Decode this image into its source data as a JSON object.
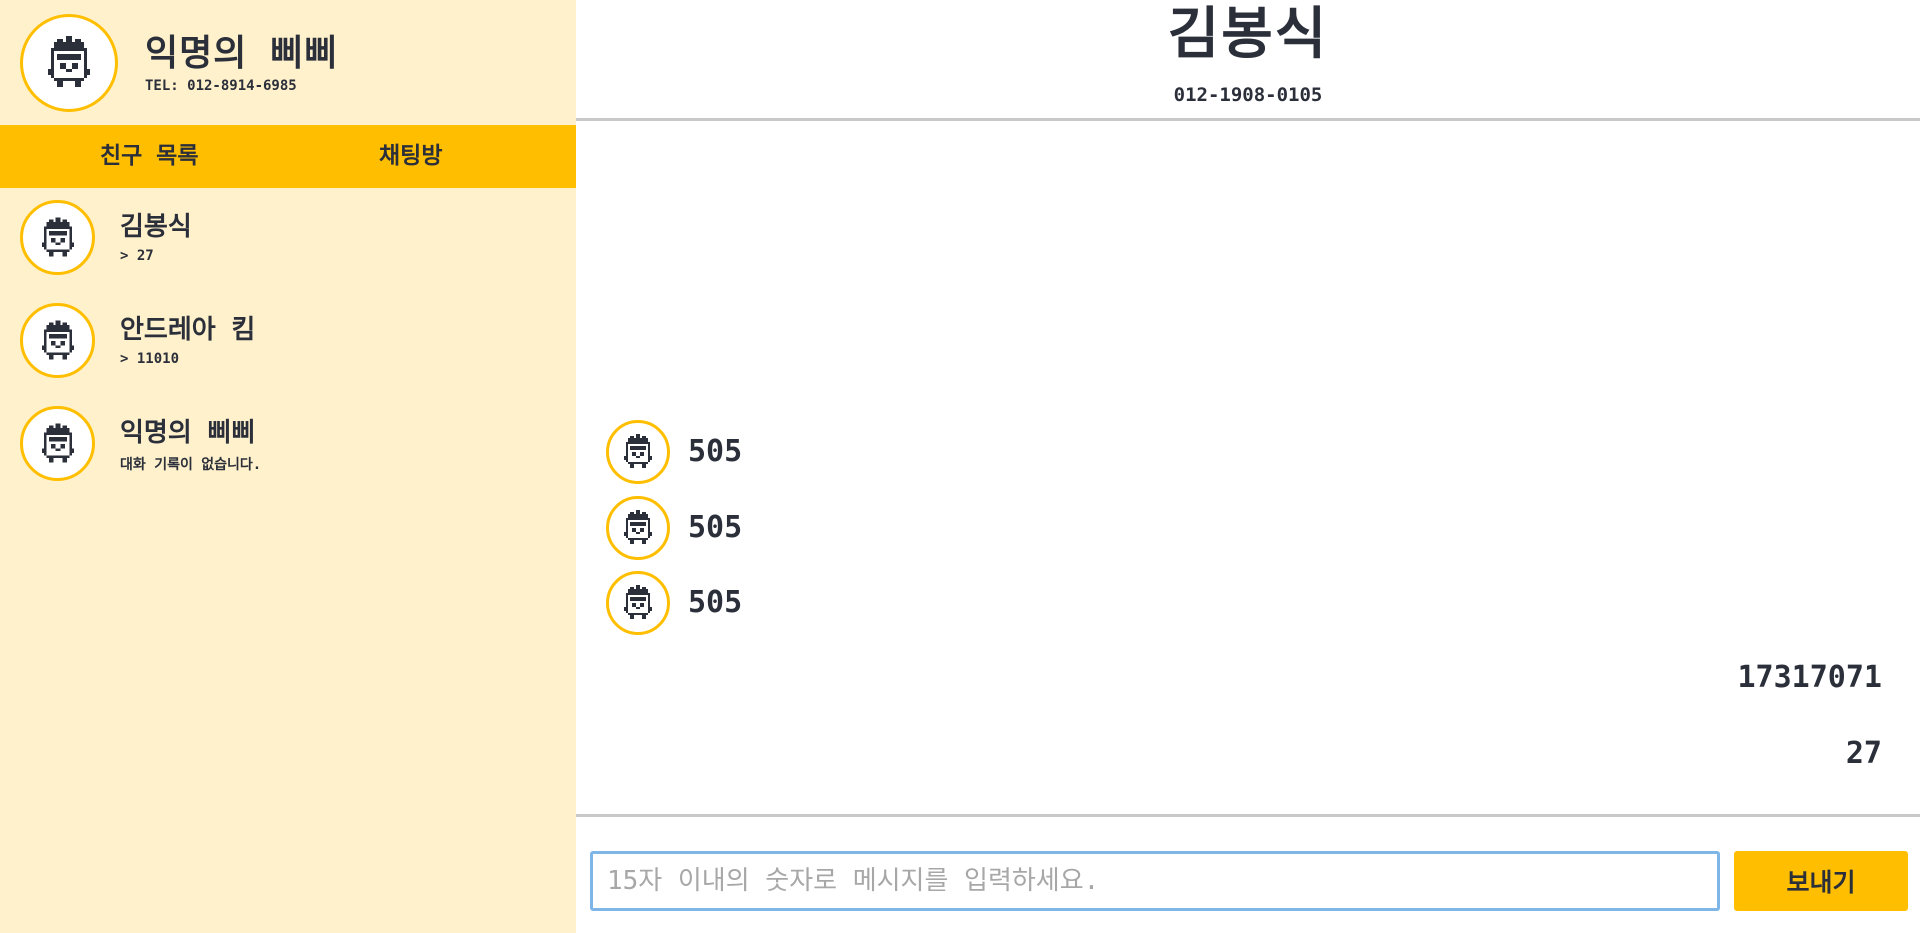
{
  "colors": {
    "accent": "#ffbf00",
    "sidebar_bg": "#fff1cc",
    "text": "#2b2f3a",
    "divider": "#c8c8c8",
    "input_border": "#7fb6e8"
  },
  "profile": {
    "name": "익명의 삐삐",
    "tel": "TEL: 012-8914-6985",
    "avatar_icon": "pixel-robot-icon"
  },
  "tabs": [
    {
      "label": "친구 목록"
    },
    {
      "label": "채팅방"
    }
  ],
  "friends": [
    {
      "name": "김봉식",
      "last_message": "> 27",
      "avatar_icon": "pixel-robot-icon"
    },
    {
      "name": "안드레아 킴",
      "last_message": "> 11010",
      "avatar_icon": "pixel-robot-icon"
    },
    {
      "name": "익명의 삐삐",
      "last_message": "대화 기록이 없습니다.",
      "avatar_icon": "pixel-robot-icon"
    }
  ],
  "chat": {
    "title": "김봉식",
    "phone": "012-1908-0105",
    "incoming": [
      {
        "text": "505"
      },
      {
        "text": "505"
      },
      {
        "text": "505"
      }
    ],
    "outgoing": [
      {
        "text": "17317071"
      },
      {
        "text": "27"
      }
    ]
  },
  "composer": {
    "value": "",
    "placeholder": "15자 이내의 숫자로 메시지를 입력하세요.",
    "send_label": "보내기"
  }
}
